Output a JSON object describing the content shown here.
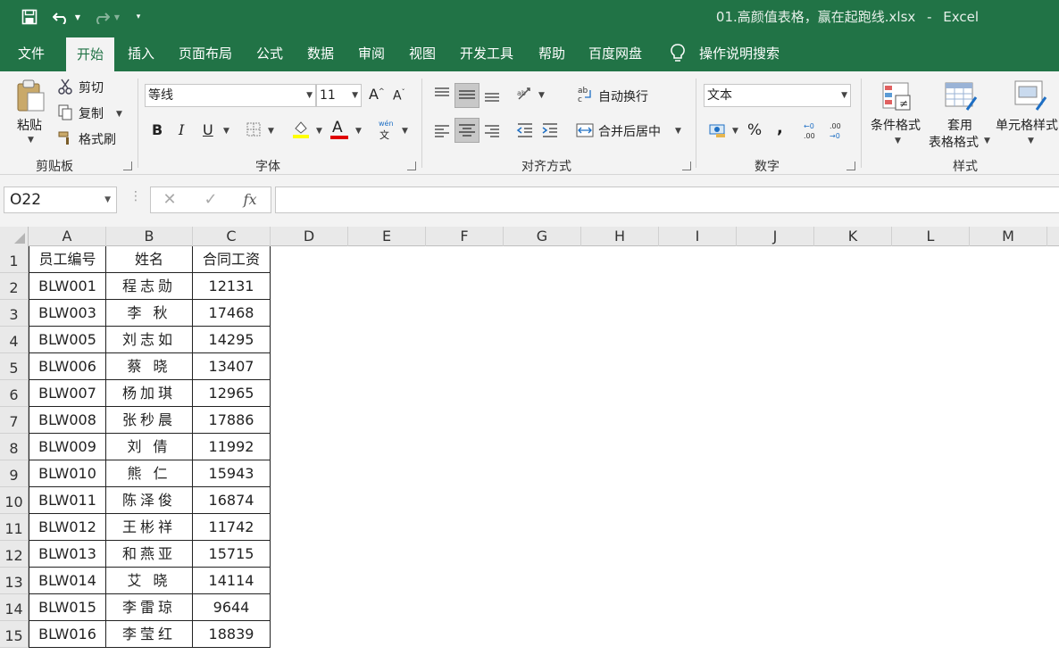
{
  "title_bar": {
    "file_name": "01.高颜值表格，赢在起跑线.xlsx",
    "separator": "-",
    "app_name": "Excel"
  },
  "tabs": [
    "文件",
    "开始",
    "插入",
    "页面布局",
    "公式",
    "数据",
    "审阅",
    "视图",
    "开发工具",
    "帮助",
    "百度网盘"
  ],
  "tell_me": "操作说明搜索",
  "ribbon": {
    "clipboard": {
      "paste": "粘贴",
      "cut": "剪切",
      "copy": "复制",
      "format_painter": "格式刷",
      "label": "剪贴板"
    },
    "font": {
      "font_name": "等线",
      "font_size": "11",
      "label": "字体",
      "bold": "B",
      "italic": "I",
      "underline": "U",
      "font_color": "A",
      "phonetic": "wén"
    },
    "alignment": {
      "wrap_text": "自动换行",
      "merge_center": "合并后居中",
      "label": "对齐方式"
    },
    "number": {
      "format": "文本",
      "percent": "%",
      "comma": ",",
      "label": "数字"
    },
    "styles": {
      "conditional": "条件格式",
      "table_format_1": "套用",
      "table_format_2": "表格格式",
      "cell_styles": "单元格样式",
      "label": "样式"
    }
  },
  "formula_bar": {
    "name_box": "O22",
    "fx": "fx",
    "value": ""
  },
  "columns": [
    "A",
    "B",
    "C",
    "D",
    "E",
    "F",
    "G",
    "H",
    "I",
    "J",
    "K",
    "L",
    "M"
  ],
  "rows": [
    "1",
    "2",
    "3",
    "4",
    "5",
    "6",
    "7",
    "8",
    "9",
    "10",
    "11",
    "12",
    "13",
    "14",
    "15"
  ],
  "table": {
    "headers": [
      "员工编号",
      "姓名",
      "合同工资"
    ],
    "rows": [
      [
        "BLW001",
        "程志勋",
        "12131"
      ],
      [
        "BLW003",
        "李 秋",
        "17468"
      ],
      [
        "BLW005",
        "刘志如",
        "14295"
      ],
      [
        "BLW006",
        "蔡 晓",
        "13407"
      ],
      [
        "BLW007",
        "杨加琪",
        "12965"
      ],
      [
        "BLW008",
        "张秒晨",
        "17886"
      ],
      [
        "BLW009",
        "刘 倩",
        "11992"
      ],
      [
        "BLW010",
        "熊 仁",
        "15943"
      ],
      [
        "BLW011",
        "陈泽俊",
        "16874"
      ],
      [
        "BLW012",
        "王彬祥",
        "11742"
      ],
      [
        "BLW013",
        "和燕亚",
        "15715"
      ],
      [
        "BLW014",
        "艾 晓",
        "14114"
      ],
      [
        "BLW015",
        "李雷琼",
        "9644"
      ],
      [
        "BLW016",
        "李莹红",
        "18839"
      ]
    ]
  }
}
